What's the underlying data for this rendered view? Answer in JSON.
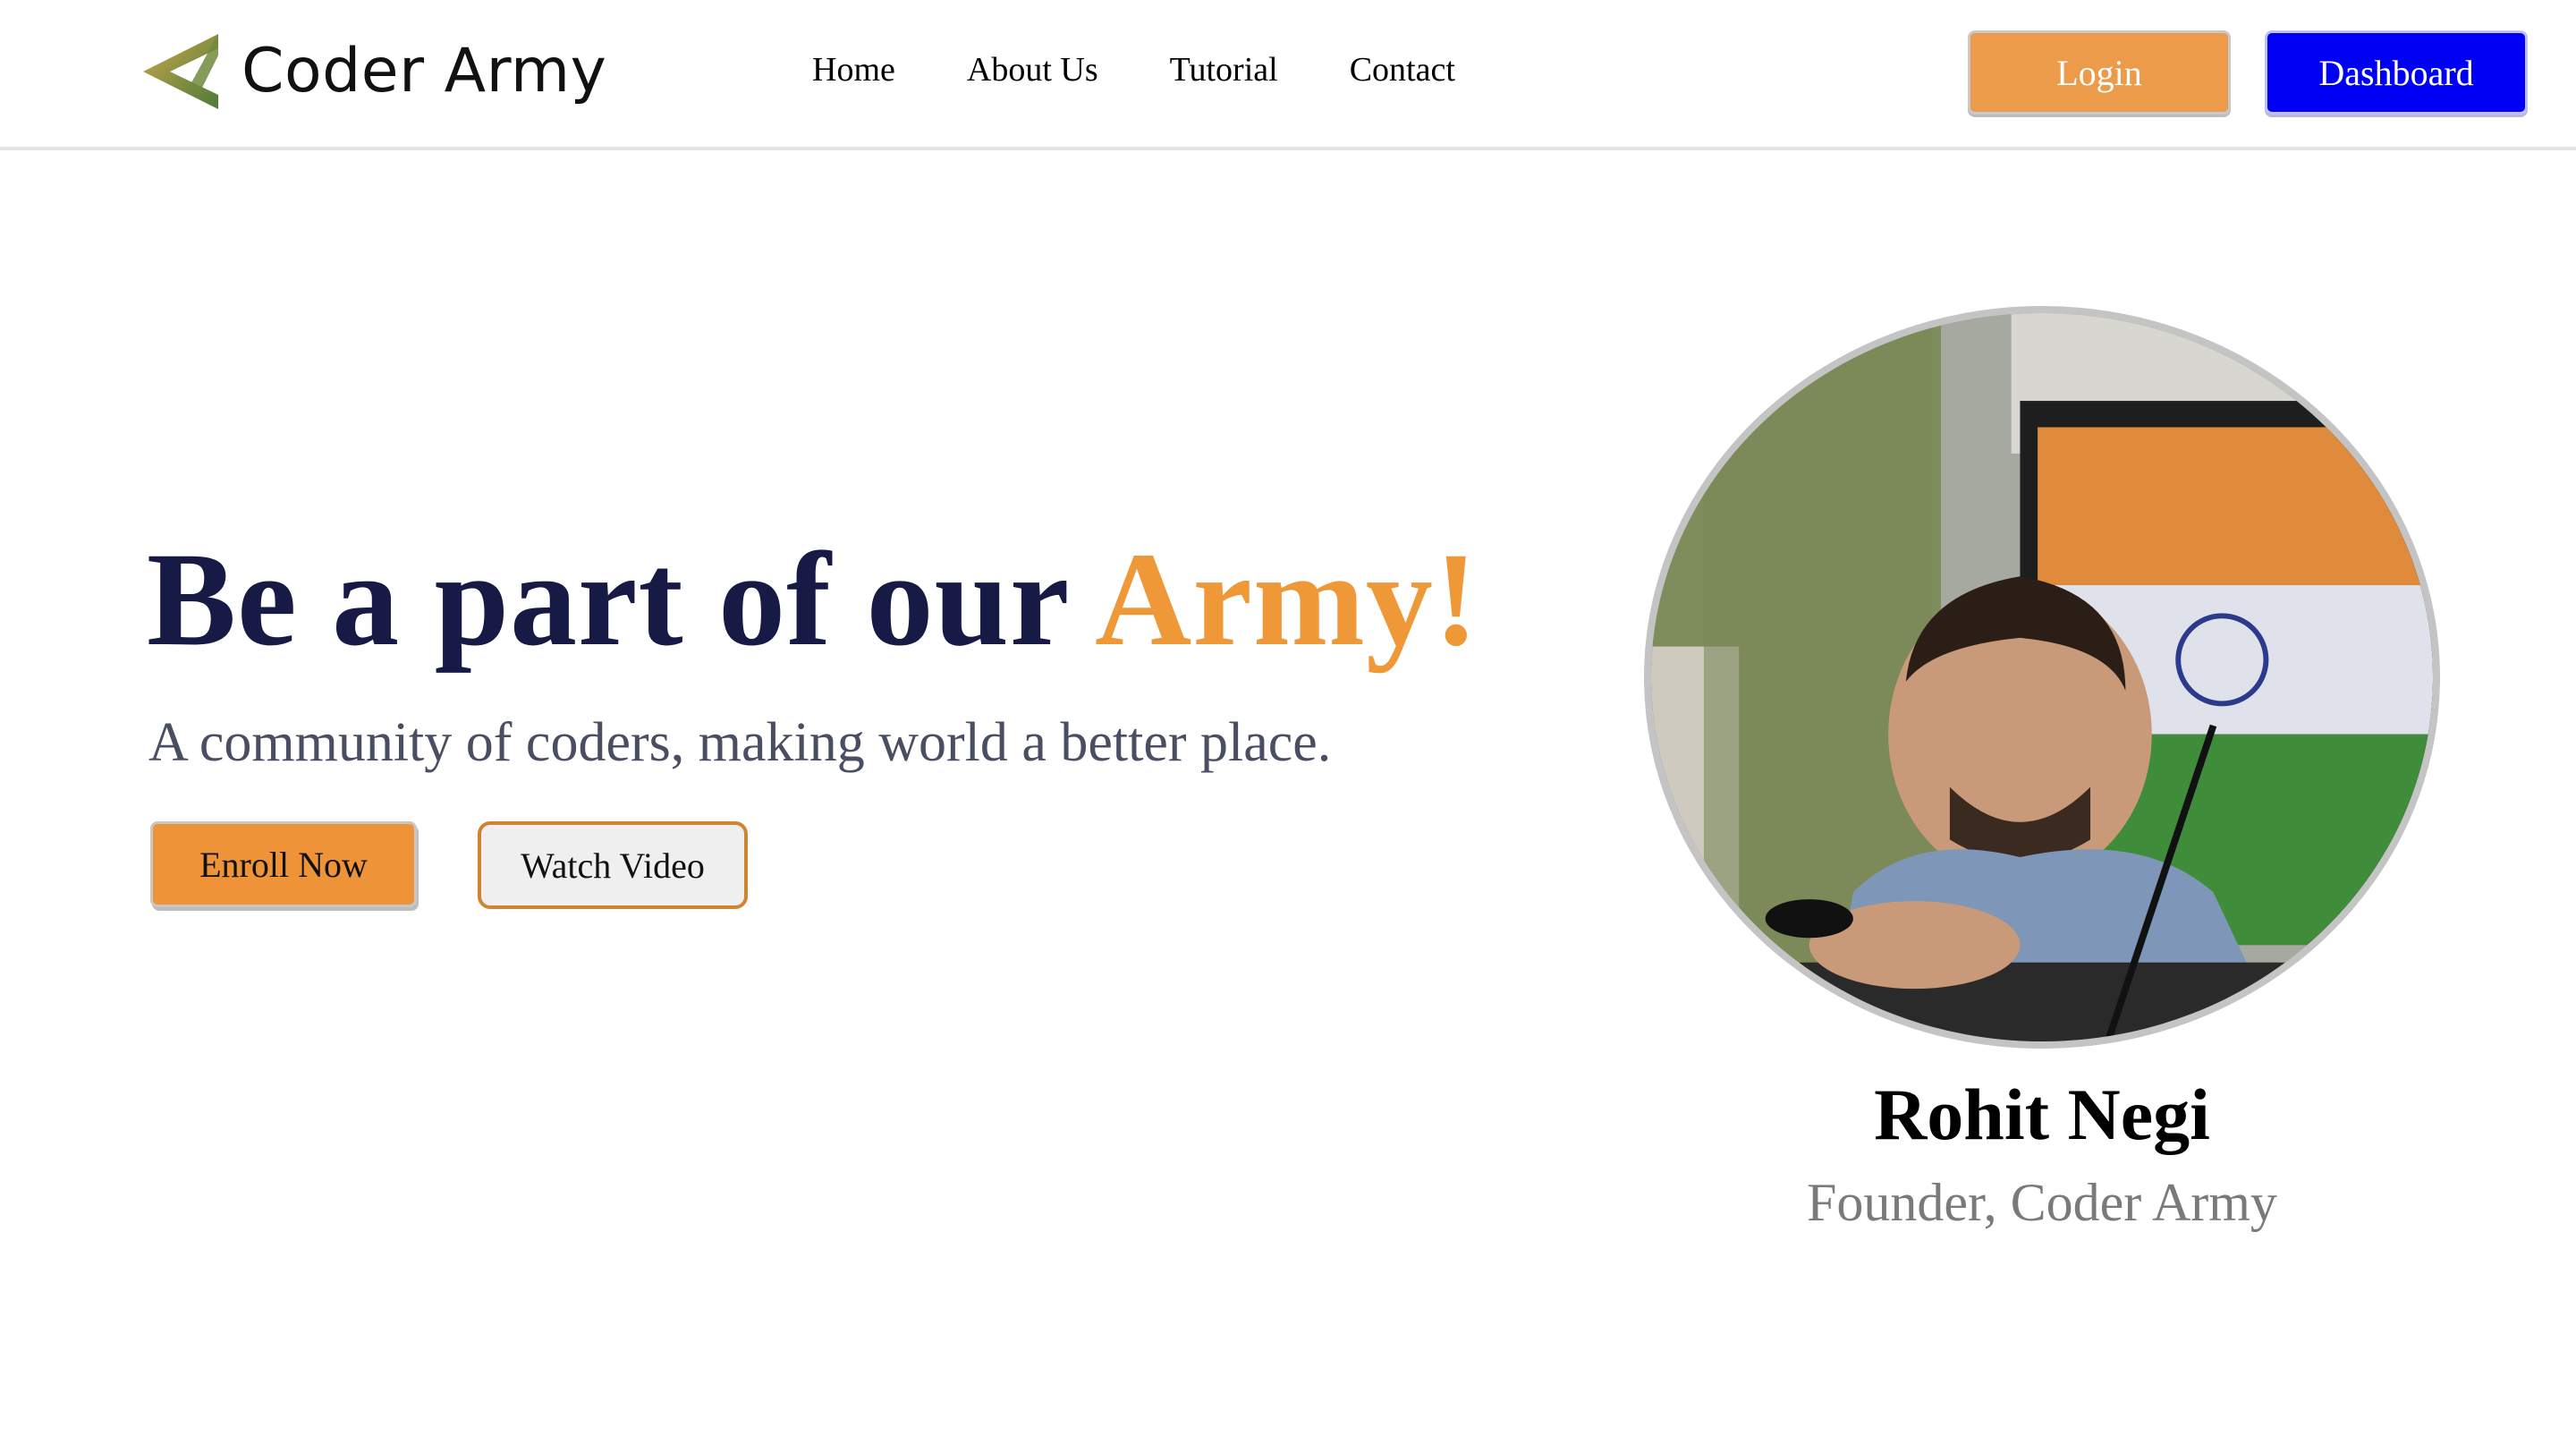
{
  "brand": {
    "name": "Coder Army",
    "logo_icon": "chevron-arrow-logo"
  },
  "nav": {
    "items": [
      {
        "label": "Home"
      },
      {
        "label": "About Us"
      },
      {
        "label": "Tutorial"
      },
      {
        "label": "Contact"
      }
    ]
  },
  "header_actions": {
    "login_label": "Login",
    "dashboard_label": "Dashboard"
  },
  "hero": {
    "title_main": "Be a part of our ",
    "title_accent": "Army!",
    "subtitle": "A community of coders, making world a better place.",
    "enroll_label": "Enroll Now",
    "watch_label": "Watch Video"
  },
  "founder": {
    "name": "Rohit Negi",
    "role": "Founder, Coder Army"
  },
  "colors": {
    "accent_orange": "#ee9838",
    "title_navy": "#161a45",
    "dashboard_blue": "#0000f5",
    "login_orange": "#eb9b4a"
  }
}
